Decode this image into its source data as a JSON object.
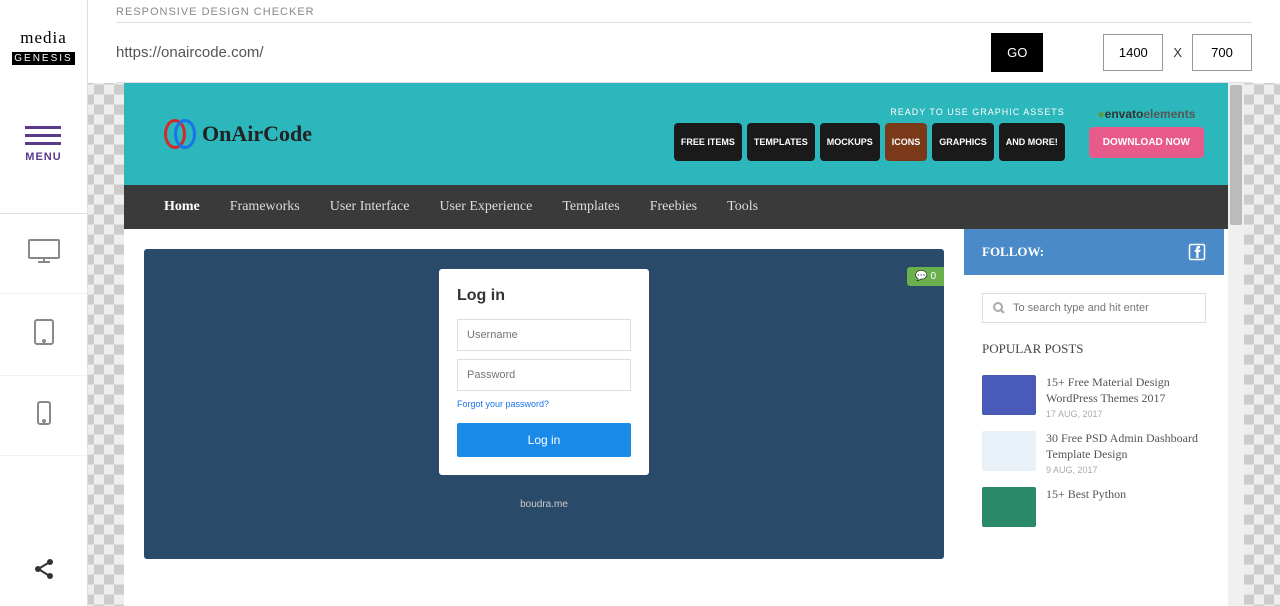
{
  "tool": {
    "brand_top": "media",
    "brand_bottom": "GENESIS",
    "menu_label": "MENU",
    "header_label": "RESPONSIVE DESIGN CHECKER",
    "url": "https://onaircode.com/",
    "go_label": "GO",
    "width": "1400",
    "height": "700",
    "dim_separator": "X"
  },
  "site": {
    "name": "OnAirCode",
    "assets_label": "READY TO USE GRAPHIC ASSETS",
    "tiles": [
      "FREE ITEMS",
      "TEMPLATES",
      "MOCKUPS",
      "ICONS",
      "GRAPHICS",
      "AND MORE!"
    ],
    "envato_brand": "envato",
    "envato_suffix": "elements",
    "download_label": "DOWNLOAD NOW",
    "nav": [
      "Home",
      "Frameworks",
      "User Interface",
      "User Experience",
      "Templates",
      "Freebies",
      "Tools"
    ],
    "comment_count": "0",
    "login": {
      "title": "Log in",
      "username_ph": "Username",
      "password_ph": "Password",
      "forgot": "Forgot your password?",
      "button": "Log in",
      "credit": "boudra.me"
    },
    "follow_label": "FOLLOW:",
    "search_placeholder": "To search type and hit enter",
    "popular_heading": "POPULAR POSTS",
    "posts": [
      {
        "title": "15+ Free Material Design WordPress Themes 2017",
        "date": "17 AUG, 2017"
      },
      {
        "title": "30 Free PSD Admin Dashboard Template Design",
        "date": "9 AUG, 2017"
      },
      {
        "title": "15+ Best Python",
        "date": ""
      }
    ]
  }
}
